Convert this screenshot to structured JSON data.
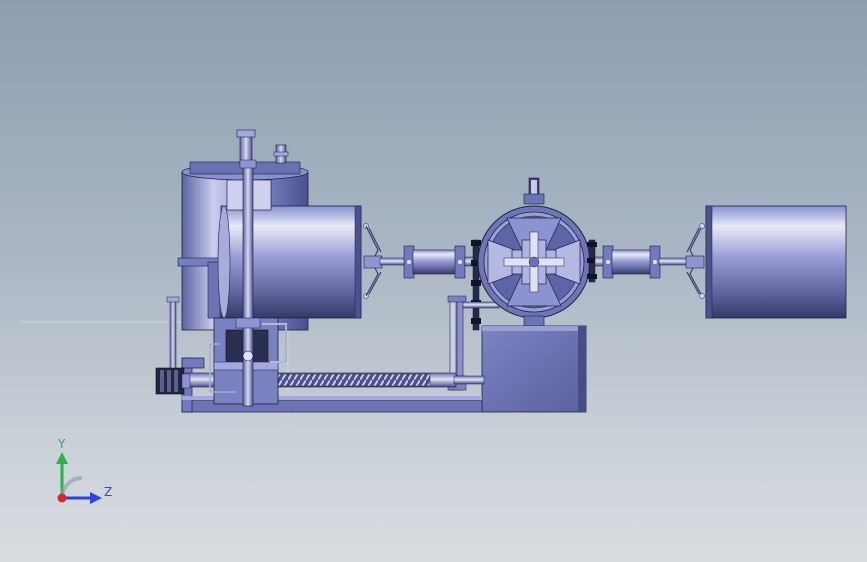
{
  "viewport": {
    "background_top": "#8e9db0",
    "background_bottom": "#d9dde1"
  },
  "model": {
    "body_color": "#7f86c8",
    "body_light": "#e4e7f6",
    "body_dark": "#3c4276",
    "outline": "#1e2140",
    "components": [
      "tank",
      "left-drum",
      "right-drum",
      "central-wheel",
      "gear-box",
      "lead-screw",
      "base-frame",
      "motor",
      "vertical-rod",
      "left-coupling",
      "right-coupling",
      "left-linkage",
      "right-linkage",
      "chain-drive"
    ]
  },
  "triad": {
    "y_label": "Y",
    "z_label": "Z",
    "y_color": "#2bb34a",
    "z_color": "#2d44d8",
    "x_color": "#d8282a"
  }
}
